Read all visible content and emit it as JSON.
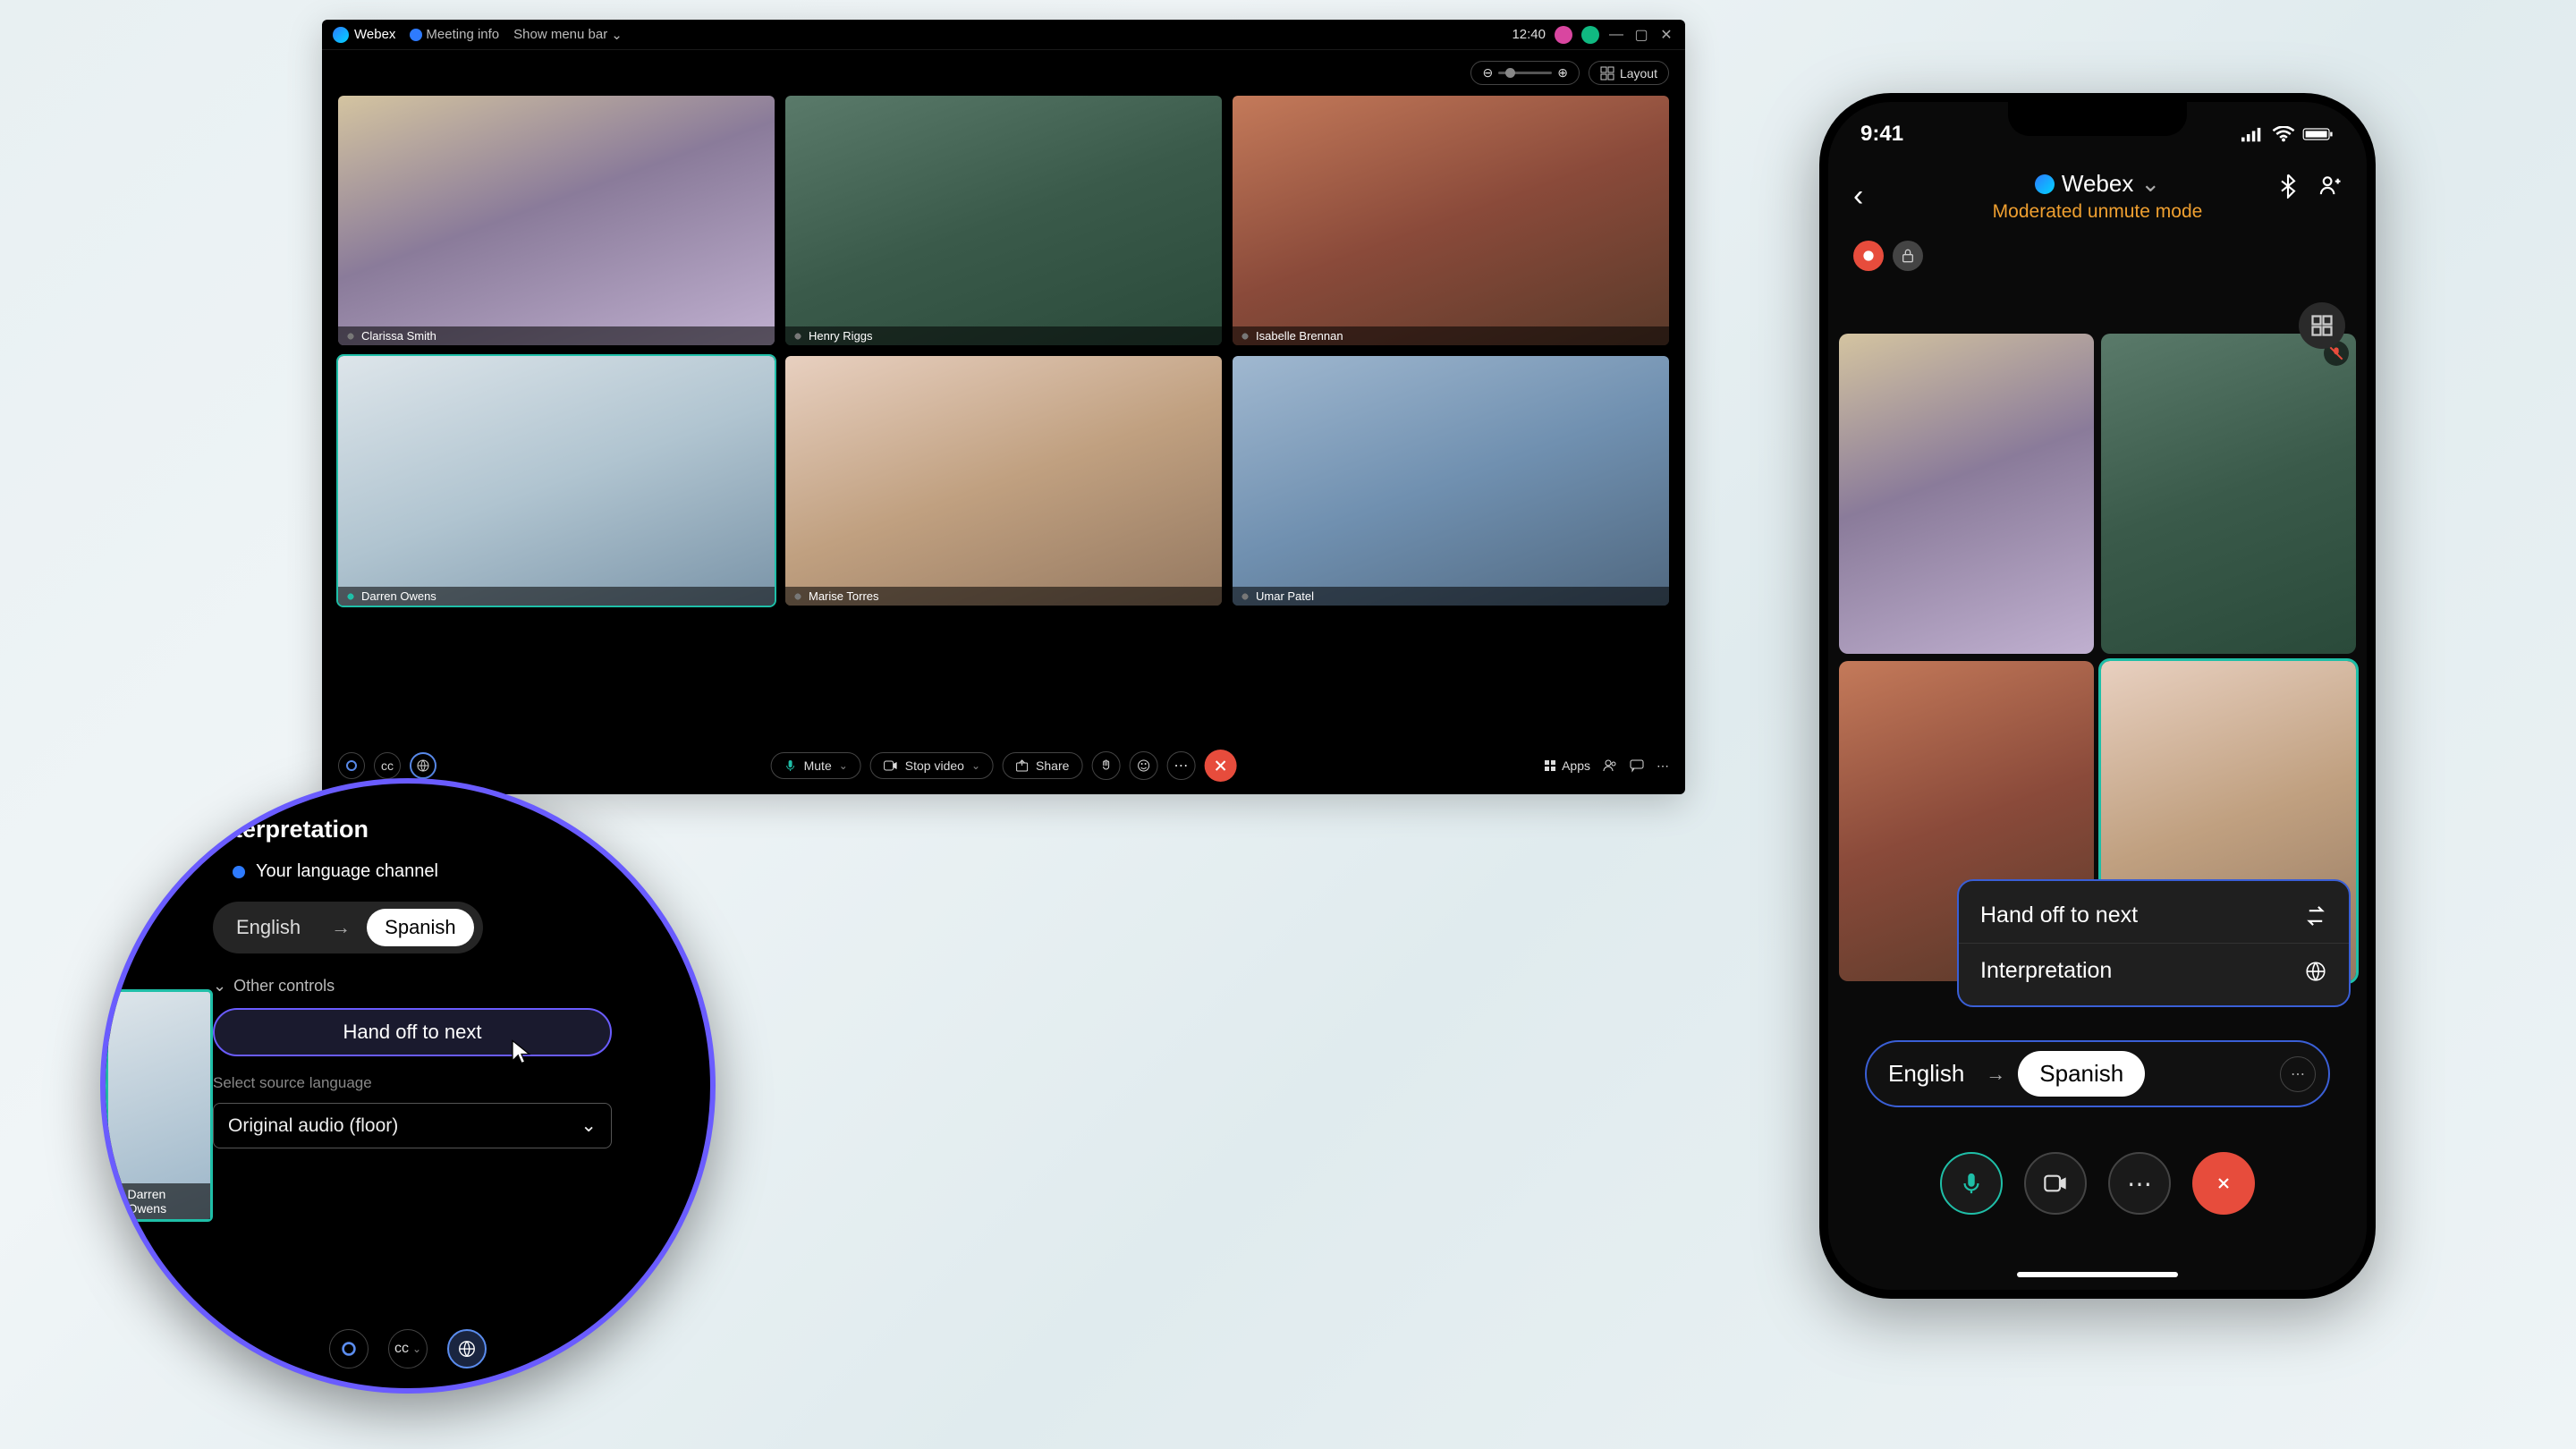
{
  "desktop": {
    "brand": "Webex",
    "meeting_info": "Meeting info",
    "show_menu": "Show menu bar",
    "clock": "12:40",
    "layout_label": "Layout",
    "participants": [
      {
        "name": "Clarissa Smith",
        "mic": "off"
      },
      {
        "name": "Henry Riggs",
        "mic": "off"
      },
      {
        "name": "Isabelle Brennan",
        "mic": "off"
      },
      {
        "name": "Darren Owens",
        "mic": "on",
        "active": true
      },
      {
        "name": "Marise Torres",
        "mic": "off"
      },
      {
        "name": "Umar Patel",
        "mic": "off"
      }
    ],
    "controls": {
      "mute": "Mute",
      "stop_video": "Stop video",
      "share": "Share",
      "apps": "Apps"
    }
  },
  "magnifier": {
    "title": "Interpretation",
    "channel_label": "Your language channel",
    "from_lang": "English",
    "to_lang": "Spanish",
    "other_controls": "Other controls",
    "handoff": "Hand off to next",
    "select_source": "Select source language",
    "source_value": "Original audio (floor)",
    "fragment_name": "Darren Owens"
  },
  "mobile": {
    "time": "9:41",
    "title": "Webex",
    "subtitle": "Moderated unmute mode",
    "popup": {
      "handoff": "Hand off to next",
      "interpretation": "Interpretation"
    },
    "langbar": {
      "from": "English",
      "to": "Spanish"
    }
  }
}
